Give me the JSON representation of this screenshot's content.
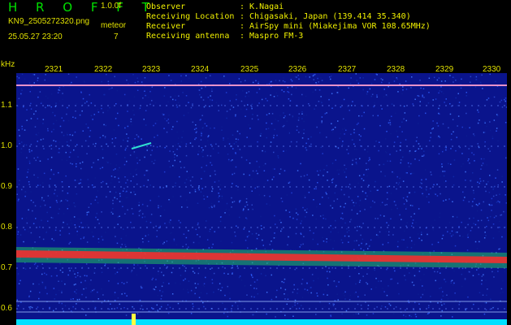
{
  "header": {
    "title": "H R O F F T",
    "version": "1.0.0f",
    "filename": "KN9_2505272320.png",
    "meteor_label": "meteor",
    "datetime": "25.05.27 23:20",
    "meteor_count": "7"
  },
  "info": [
    {
      "key": "Observer",
      "value": ": K.Nagai"
    },
    {
      "key": "Receiving Location",
      "value": ": Chigasaki, Japan (139.414 35.340)"
    },
    {
      "key": "Receiver",
      "value": ": AirSpy mini (Miakejima VOR 108.65MHz)"
    },
    {
      "key": "Receiving antenna",
      "value": ": Maspro FM-3"
    }
  ],
  "y_axis": {
    "unit": "kHz",
    "ticks": [
      "1.1",
      "1.0",
      "0.9",
      "0.8",
      "0.7",
      "0.6"
    ]
  },
  "x_axis": {
    "ticks": [
      "2321",
      "2322",
      "2323",
      "2324",
      "2325",
      "2326",
      "2327",
      "2328",
      "2329",
      "2330"
    ]
  },
  "colors": {
    "background": "#0a148c",
    "band": "#ff2a2a",
    "text": "#e0e000",
    "title": "#00e000",
    "baseline": "#00e0ff"
  }
}
